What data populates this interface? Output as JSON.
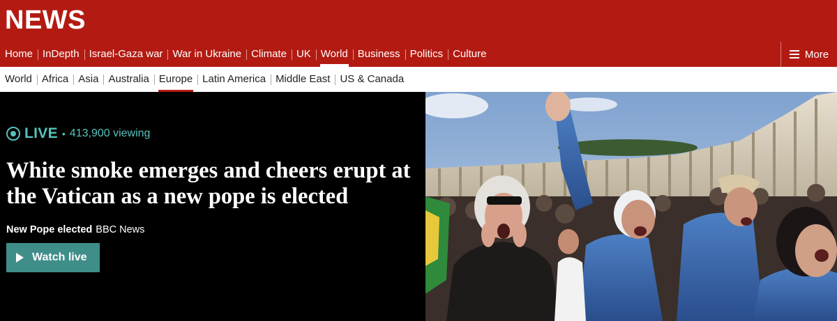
{
  "header": {
    "brand": "NEWS"
  },
  "nav": {
    "items": [
      {
        "label": "Home"
      },
      {
        "label": "InDepth"
      },
      {
        "label": "Israel-Gaza war"
      },
      {
        "label": "War in Ukraine"
      },
      {
        "label": "Climate"
      },
      {
        "label": "UK"
      },
      {
        "label": "World",
        "active": true
      },
      {
        "label": "Business"
      },
      {
        "label": "Politics"
      },
      {
        "label": "Culture"
      }
    ],
    "more_label": "More"
  },
  "subnav": {
    "items": [
      {
        "label": "World"
      },
      {
        "label": "Africa"
      },
      {
        "label": "Asia"
      },
      {
        "label": "Australia"
      },
      {
        "label": "Europe",
        "active": true
      },
      {
        "label": "Latin America"
      },
      {
        "label": "Middle East"
      },
      {
        "label": "US & Canada"
      }
    ]
  },
  "hero": {
    "live_label": "LIVE",
    "separator": "•",
    "viewing": "413,900 viewing",
    "headline": "White smoke emerges and cheers erupt at the Vatican as a new pope is elected",
    "tag": "New Pope elected",
    "source": "BBC News",
    "watch_label": "Watch live",
    "photo_alt": "Crowd cheering in St Peter's Square"
  },
  "colors": {
    "brand_red": "#b31b12",
    "live_teal": "#58c1bd",
    "button_teal": "#3f8e8a"
  }
}
